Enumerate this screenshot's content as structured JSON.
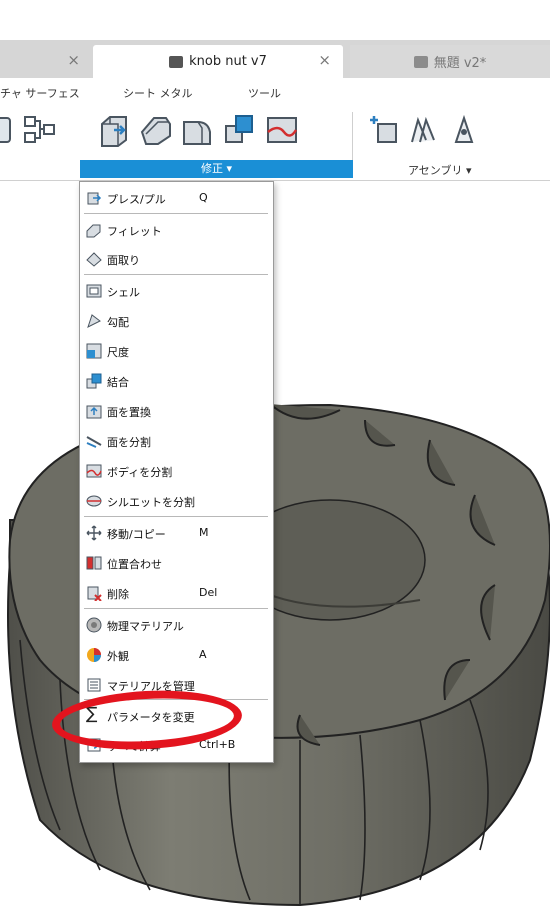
{
  "tabs": {
    "left": {
      "title": "",
      "close": "×"
    },
    "active": {
      "title": "knob nut v7",
      "close": "×"
    },
    "right": {
      "title": "無題 v2*"
    }
  },
  "ribbon": {
    "labels": {
      "surface": "チャ サーフェス",
      "sheet_metal": "シート メタル",
      "tools": "ツール"
    },
    "modify": "修正 ▾",
    "assembly": "アセンブリ ▾"
  },
  "menu": {
    "items": [
      {
        "label": "プレス/プル",
        "key": "Q"
      },
      {
        "label": "フィレット",
        "key": ""
      },
      {
        "label": "面取り",
        "key": ""
      },
      {
        "label": "シェル",
        "key": ""
      },
      {
        "label": "勾配",
        "key": ""
      },
      {
        "label": "尺度",
        "key": ""
      },
      {
        "label": "結合",
        "key": ""
      },
      {
        "label": "面を置換",
        "key": ""
      },
      {
        "label": "面を分割",
        "key": ""
      },
      {
        "label": "ボディを分割",
        "key": ""
      },
      {
        "label": "シルエットを分割",
        "key": ""
      },
      {
        "label": "移動/コピー",
        "key": "M"
      },
      {
        "label": "位置合わせ",
        "key": ""
      },
      {
        "label": "削除",
        "key": "Del"
      },
      {
        "label": "物理マテリアル",
        "key": ""
      },
      {
        "label": "外観",
        "key": "A"
      },
      {
        "label": "マテリアルを管理",
        "key": ""
      },
      {
        "label": "パラメータを変更",
        "key": ""
      },
      {
        "label": "すべて計算",
        "key": "Ctrl+B"
      }
    ]
  },
  "colors": {
    "accent": "#1a8fd6",
    "highlight_ring": "#e3141e",
    "knob": "#6b6b63"
  }
}
